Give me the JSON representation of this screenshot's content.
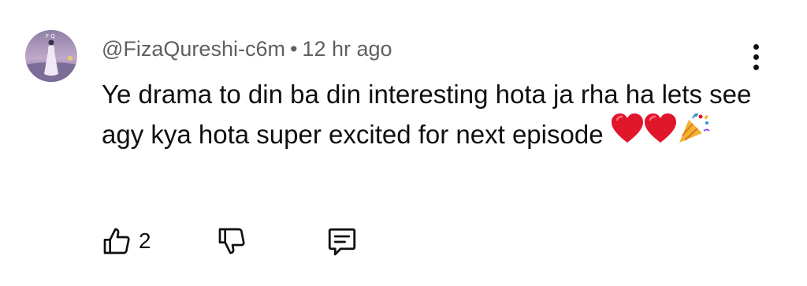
{
  "comment": {
    "author": "@FizaQureshi-c6m",
    "separator": "•",
    "timestamp": "12 hr ago",
    "text": "Ye drama to din ba din interesting hota ja rha ha lets see agy kya hota super excited for next episode",
    "emojis": [
      "red-heart",
      "red-heart",
      "party-popper"
    ]
  },
  "actions": {
    "like_count": "2",
    "like_icon": "thumbs-up-icon",
    "dislike_icon": "thumbs-down-icon",
    "reply_icon": "comment-icon"
  },
  "menu_icon": "more-vertical-icon",
  "colors": {
    "meta_text": "#606060",
    "body_text": "#0f0f0f",
    "heart": "#e0162b"
  }
}
